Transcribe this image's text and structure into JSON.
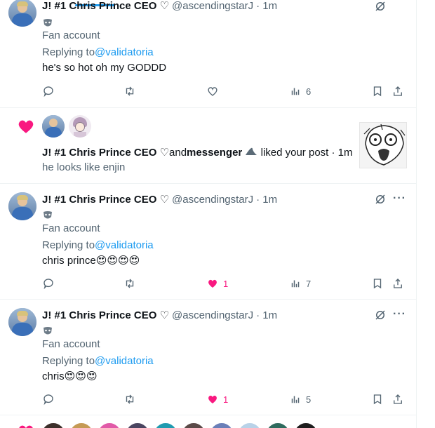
{
  "tweets": [
    {
      "name": "J! #1 Chris Prince CEO ♡",
      "handle": "@ascendingstarJ",
      "time": "· 1m",
      "bio_label": "Fan account",
      "replying_prefix": "Replying to",
      "replying_handle": "@validatoria",
      "text": "he's so hot oh my GODDD",
      "likes": "",
      "views": "6",
      "liked": false
    },
    {
      "name": "J! #1 Chris Prince CEO ♡",
      "handle": "@ascendingstarJ",
      "time": "· 1m",
      "bio_label": "Fan account",
      "replying_prefix": "Replying to",
      "replying_handle": "@validatoria",
      "text": "chris prince😍😍😍😍",
      "likes": "1",
      "views": "7",
      "liked": true
    },
    {
      "name": "J! #1 Chris Prince CEO ♡",
      "handle": "@ascendingstarJ",
      "time": "· 1m",
      "bio_label": "Fan account",
      "replying_prefix": "Replying to",
      "replying_handle": "@validatoria",
      "text": "chris😍😍😍",
      "likes": "1",
      "views": "5",
      "liked": true
    }
  ],
  "notification": {
    "user1": "J! #1 Chris Prince CEO ♡",
    "and": "and",
    "user2": "messenger",
    "action": "liked your post · 1m",
    "post_text": "he looks like enjin"
  },
  "colors": {
    "accent": "#1d9bf0",
    "like": "#f91880",
    "muted": "#536471"
  },
  "icons": [
    "reply-icon",
    "retweet-icon",
    "heart-icon",
    "views-icon",
    "bookmark-icon",
    "share-icon",
    "grok-icon",
    "more-icon",
    "mask-badge-icon"
  ]
}
